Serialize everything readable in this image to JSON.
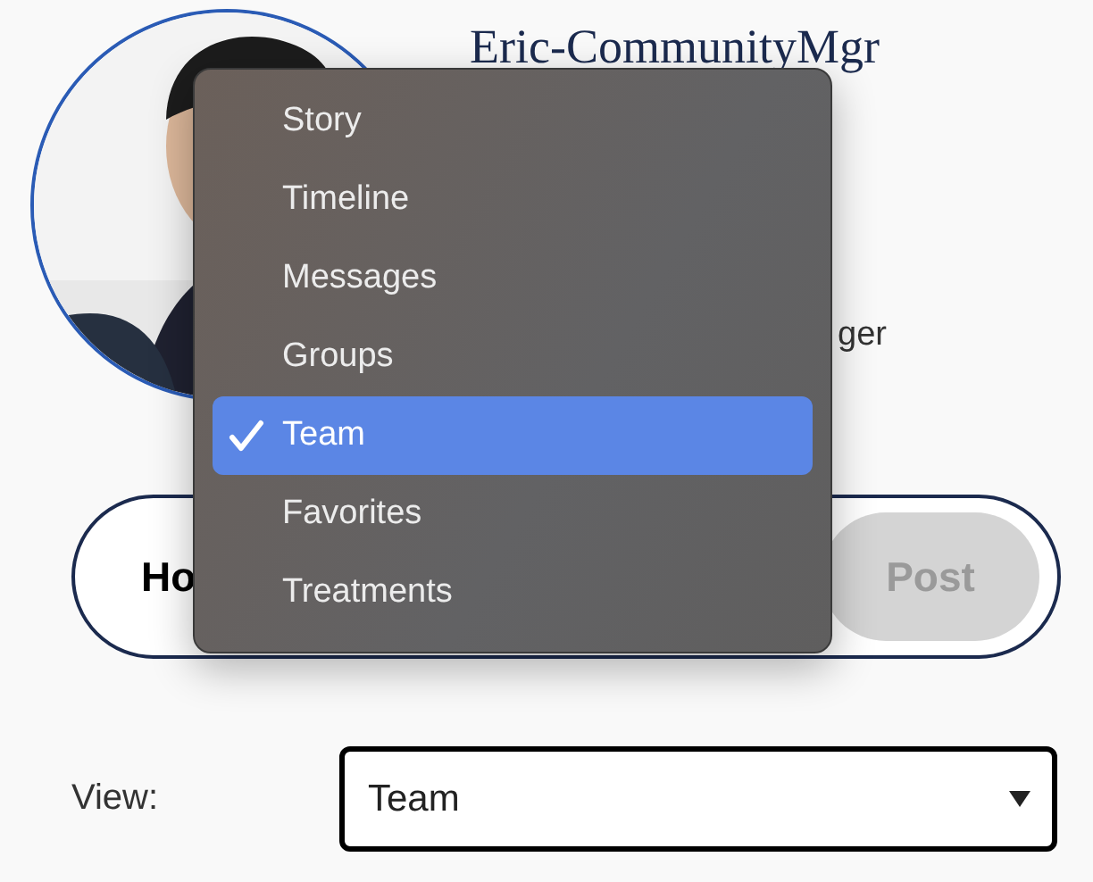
{
  "profile": {
    "name": "Eric-CommunityMgr",
    "subtitle": "ger"
  },
  "composer": {
    "placeholder": "Ho",
    "post_button": {
      "label": "Post",
      "disabled": true
    }
  },
  "view": {
    "label": "View:",
    "value": "Team"
  },
  "menu": {
    "items": [
      {
        "label": "Story",
        "selected": false
      },
      {
        "label": "Timeline",
        "selected": false
      },
      {
        "label": "Messages",
        "selected": false
      },
      {
        "label": "Groups",
        "selected": false
      },
      {
        "label": "Team",
        "selected": true
      },
      {
        "label": "Favorites",
        "selected": false
      },
      {
        "label": "Treatments",
        "selected": false
      }
    ]
  }
}
